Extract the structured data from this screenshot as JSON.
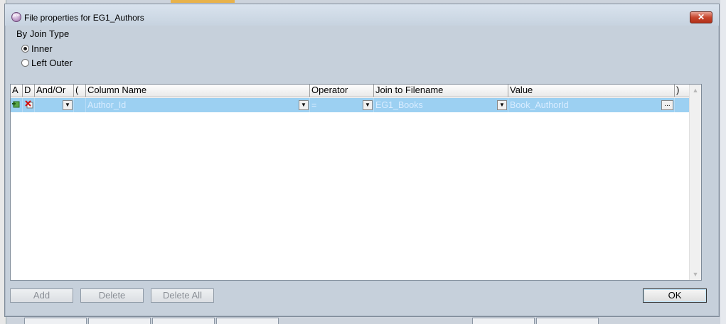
{
  "window": {
    "title": "File properties for EG1_Authors",
    "close_label": "✕"
  },
  "join_type": {
    "label": "By Join Type",
    "options": [
      {
        "label": "Inner",
        "selected": true
      },
      {
        "label": "Left Outer",
        "selected": false
      }
    ]
  },
  "grid": {
    "headers": [
      "A",
      "D",
      "And/Or",
      "(",
      "Column Name",
      "Operator",
      "Join to Filename",
      "Value",
      ")"
    ],
    "rows": [
      {
        "and_or": "",
        "open_paren": "",
        "column_name": "Author_Id",
        "operator": "=",
        "join_to_filename": "EG1_Books",
        "value": "Book_AuthorId",
        "close_paren": ""
      }
    ]
  },
  "buttons": {
    "add": "Add",
    "delete": "Delete",
    "delete_all": "Delete All",
    "ok": "OK"
  }
}
